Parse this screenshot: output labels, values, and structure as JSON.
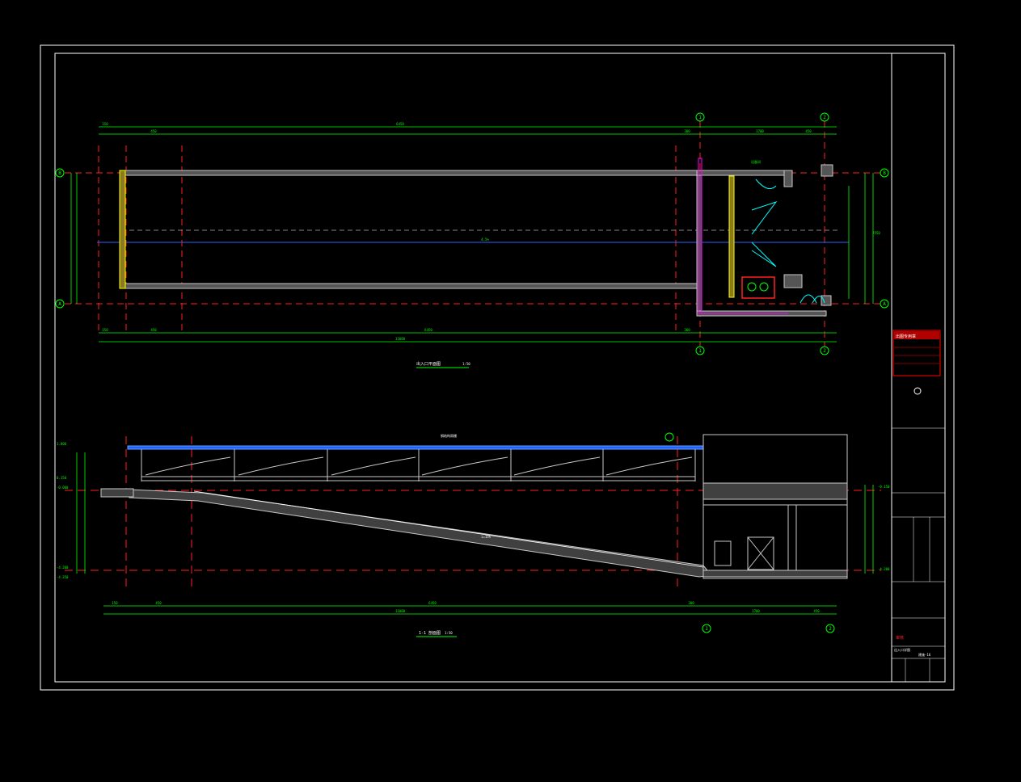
{
  "colors": {
    "background": "#000000",
    "frame": "#ffffff",
    "wall": "#c8c8c8",
    "dimension": "#00ff00",
    "axis": "#ff2020",
    "centerline": "#3060ff",
    "door": "#00ffff",
    "accent_magenta": "#ff00ff",
    "stair_yellow": "#ffff00",
    "stamp_red": "#ff0000"
  },
  "plan": {
    "title": "出入口平面图",
    "scale": "1:50",
    "axis_top": [
      "1",
      "2"
    ],
    "axis_bottom": [
      "1",
      "2"
    ],
    "axis_left": [
      "B",
      "A"
    ],
    "axis_right": [
      "B",
      "A"
    ],
    "dims_top": [
      "150",
      "450",
      "6450",
      "300",
      "1700",
      "450"
    ],
    "dim_center": "4.5%",
    "dims_bottom": [
      "150",
      "450",
      "6450",
      "300"
    ],
    "dim_overall_bottom": "11000",
    "dim_overall_right": "2550",
    "room_label": "设备间"
  },
  "section": {
    "title": "1-1 剖面图",
    "scale": "1:50",
    "axis_bottom": [
      "1",
      "2"
    ],
    "elevations_left": [
      "1.800",
      "0.150",
      "-0.000",
      "-4.200",
      "-4.350"
    ],
    "elevations_right": [
      "-0.150",
      "-4.200"
    ],
    "dims_bottom": [
      "150",
      "450",
      "6450",
      "300",
      "1700",
      "450"
    ],
    "dim_overall_bottom": "11000",
    "canopy_note": "钢结构雨棚",
    "ramp_note": "i=15%"
  },
  "title_block": {
    "stamp": "出图专用章",
    "sheet": "出入口详图",
    "drawing_no": "建施-16",
    "red_text": "审核"
  }
}
